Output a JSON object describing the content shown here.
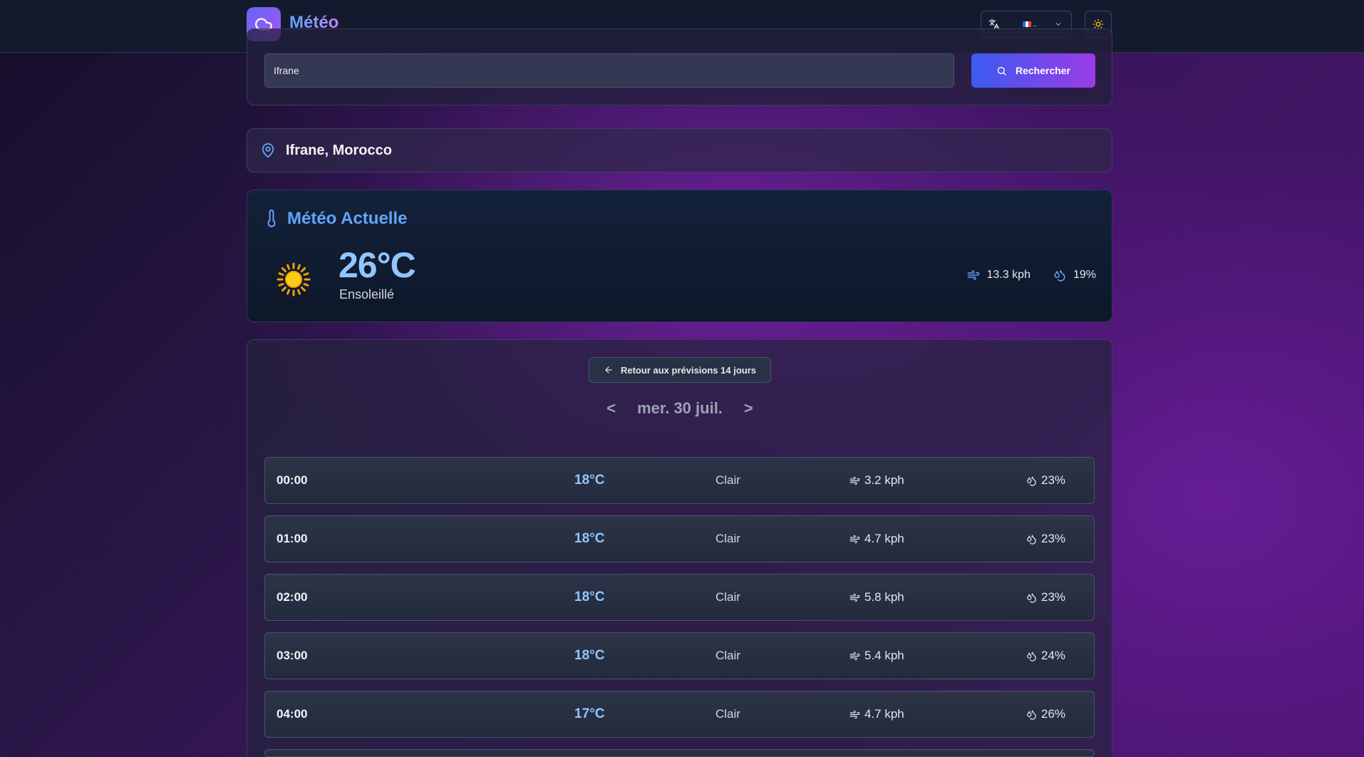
{
  "header": {
    "app_name": "Météo",
    "language_short": "..",
    "language_flag": "fr"
  },
  "search": {
    "value": "Ifrane",
    "placeholder": "",
    "button_label": "Rechercher"
  },
  "location": {
    "name": "Ifrane, Morocco"
  },
  "current": {
    "title": "Météo Actuelle",
    "temperature": "26°C",
    "condition": "Ensoleillé",
    "wind": "13.3 kph",
    "humidity": "19%",
    "icon": "sun-icon"
  },
  "hourly": {
    "back_label": "Retour aux prévisions 14 jours",
    "day_label": "mer. 30 juil.",
    "prev_label": "<",
    "next_label": ">",
    "rows": [
      {
        "time": "00:00",
        "icon": "moon-icon",
        "temp": "18°C",
        "cond": "Clair",
        "wind": "3.2 kph",
        "hum": "23%"
      },
      {
        "time": "01:00",
        "icon": "moon-icon",
        "temp": "18°C",
        "cond": "Clair",
        "wind": "4.7 kph",
        "hum": "23%"
      },
      {
        "time": "02:00",
        "icon": "moon-icon",
        "temp": "18°C",
        "cond": "Clair",
        "wind": "5.8 kph",
        "hum": "23%"
      },
      {
        "time": "03:00",
        "icon": "moon-icon",
        "temp": "18°C",
        "cond": "Clair",
        "wind": "5.4 kph",
        "hum": "24%"
      },
      {
        "time": "04:00",
        "icon": "moon-icon",
        "temp": "17°C",
        "cond": "Clair",
        "wind": "4.7 kph",
        "hum": "26%"
      }
    ]
  },
  "colors": {
    "accent_blue": "#60a5fa",
    "temp_blue": "#93c5fd",
    "brand_gradient_start": "#6366f1",
    "brand_gradient_end": "#a855f7"
  }
}
